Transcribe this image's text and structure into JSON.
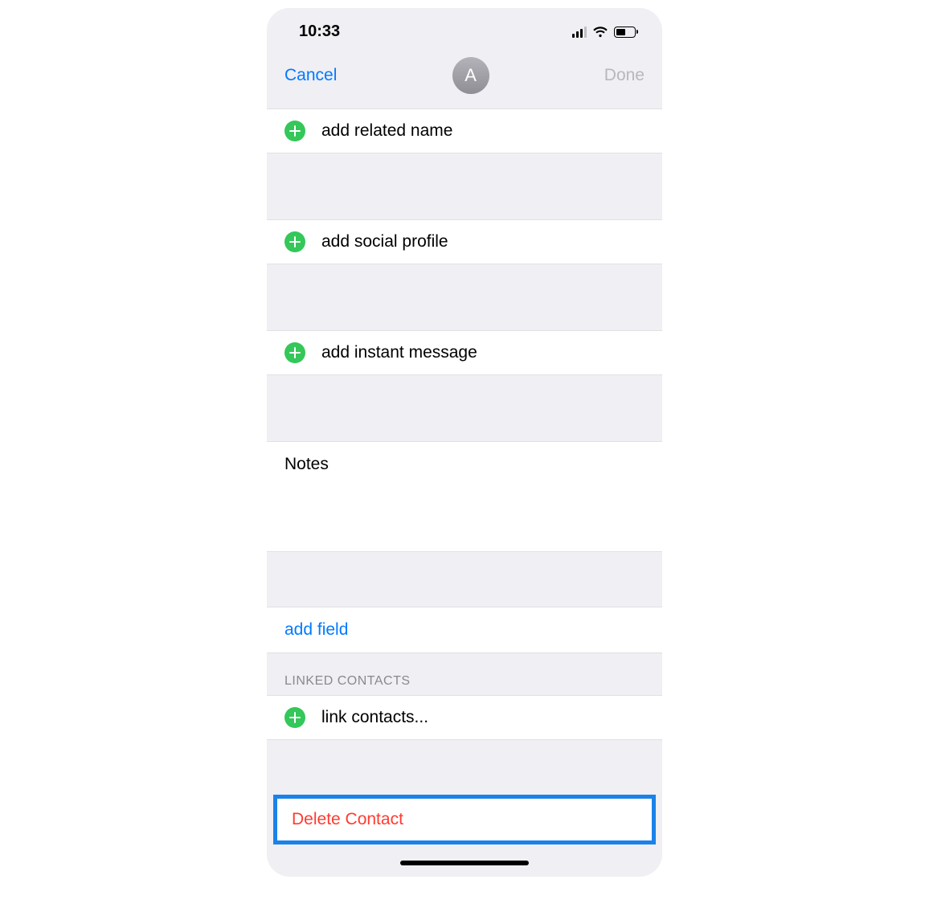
{
  "status": {
    "time": "10:33"
  },
  "nav": {
    "cancel": "Cancel",
    "done": "Done",
    "avatar_initial": "A"
  },
  "rows": {
    "related_name": "add related name",
    "social_profile": "add social profile",
    "instant_message": "add instant message",
    "link_contacts": "link contacts..."
  },
  "notes_label": "Notes",
  "add_field": "add field",
  "linked_contacts_header": "LINKED CONTACTS",
  "delete_contact": "Delete Contact"
}
